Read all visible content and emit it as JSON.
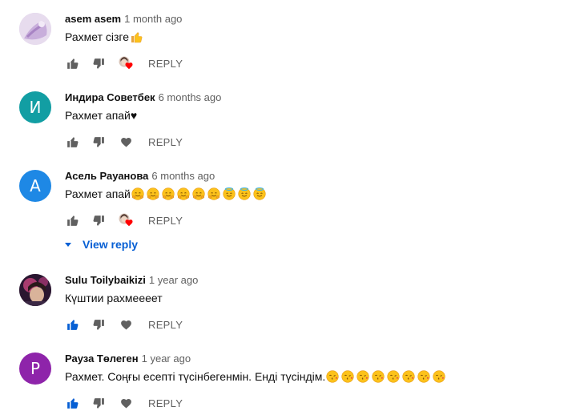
{
  "comments": [
    {
      "author": "asem asem",
      "time": "1 month ago",
      "text": "Рахмет сізге",
      "emoji": [
        "thumbs-up"
      ],
      "avatar": {
        "type": "photo",
        "bg": "#d6c2e2"
      },
      "liked": false,
      "creator_heart": true,
      "reply_label": "REPLY"
    },
    {
      "author": "Индира Советбек",
      "time": "6 months ago",
      "text": "Рахмет апай♥",
      "emoji": [],
      "avatar": {
        "type": "letter",
        "letter": "И",
        "bg": "#129ea3"
      },
      "liked": false,
      "creator_heart": false,
      "reply_label": "REPLY"
    },
    {
      "author": "Асель Рауанова",
      "time": "6 months ago",
      "text": "Рахмет апай",
      "emoji": [
        "hug",
        "hug",
        "hug",
        "hug",
        "hug",
        "hug",
        "halo",
        "halo",
        "halo"
      ],
      "avatar": {
        "type": "letter",
        "letter": "А",
        "bg": "#1e88e5"
      },
      "liked": false,
      "creator_heart": true,
      "reply_label": "REPLY",
      "view_reply": "View reply"
    },
    {
      "author": "Sulu Toilybaikizi",
      "time": "1 year ago",
      "text": "Күштии рахмеееет",
      "emoji": [],
      "avatar": {
        "type": "photo",
        "bg": "#3a2340"
      },
      "liked": true,
      "creator_heart": false,
      "reply_label": "REPLY"
    },
    {
      "author": "Рауза Төлеген",
      "time": "1 year ago",
      "text": "Рахмет. Соңғы есепті түсінбегенмін. Енді түсіндім.",
      "emoji": [
        "kiss",
        "kiss",
        "kiss",
        "kiss",
        "kiss",
        "kiss",
        "kiss",
        "kiss"
      ],
      "avatar": {
        "type": "letter",
        "letter": "Р",
        "bg": "#8e24aa"
      },
      "liked": true,
      "creator_heart": false,
      "reply_label": "REPLY"
    }
  ],
  "colors": {
    "icon_gray": "#606060",
    "like_active": "#065fd4",
    "link_blue": "#065fd4",
    "heart_red": "#ff0000"
  }
}
